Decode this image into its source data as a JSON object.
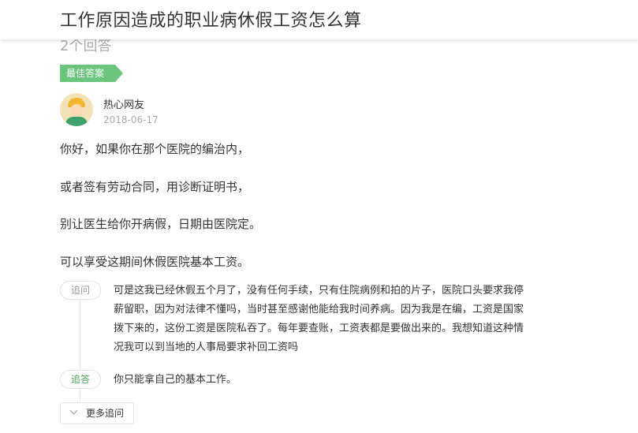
{
  "header": {
    "title": "工作原因造成的职业病休假工资怎么算"
  },
  "answers": {
    "count_label": "2个回答"
  },
  "best_answer": {
    "badge": "最佳答案",
    "user": "热心网友",
    "date": "2018-06-17",
    "paragraphs": [
      "你好，如果你在那个医院的编治内，",
      "或者签有劳动合同，用诊断证明书，",
      "别让医生给你开病假，日期由医院定。",
      "可以享受这期间休假医院基本工资。"
    ]
  },
  "thread": {
    "followup_label": "追问",
    "followup_text": "可是这我已经休假五个月了，没有任何手续，只有住院病例和拍的片子，医院口头要求我停薪留职，因为对法律不懂吗，当时甚至感谢他能给我时间养病。因为我是在编，工资是国家拨下来的，这份工资是医院私吞了。每年要查账，工资表都是要做出来的。我想知道这种情况我可以到当地的人事局要求补回工资吗",
    "reply_label": "追答",
    "reply_text": "你只能拿自己的基本工作。",
    "more_label": "更多追问"
  }
}
